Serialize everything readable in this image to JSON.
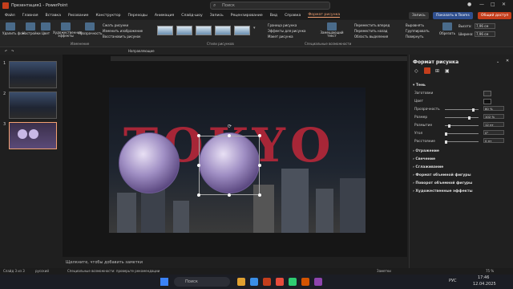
{
  "titlebar": {
    "title": "Презентация1 - PowerPoint",
    "search": "Поиск"
  },
  "menu": [
    "Файл",
    "Главная",
    "Вставка",
    "Рисование",
    "Конструктор",
    "Переходы",
    "Анимация",
    "Слайд-шоу",
    "Запись",
    "Рецензирование",
    "Вид",
    "Справка",
    "Формат рисунка"
  ],
  "header_buttons": {
    "record": "Запись",
    "teams": "Показать в Teams",
    "share": "Общий доступ"
  },
  "ribbon": {
    "adjust_items": [
      "Удалить фон",
      "Настройки",
      "Цвет",
      "Художественные эффекты",
      "Прозрачность"
    ],
    "image_menu": [
      "Сжать рисунки",
      "Изменить изображение",
      "Восстановить рисунок"
    ],
    "adjust_group": "Изменение",
    "style_group": "Стили рисунков",
    "style_menu": [
      "Граница рисунка",
      "Эффекты для рисунка",
      "Макет рисунка"
    ],
    "alt_text": "Замещающий текст",
    "accessibility_group": "Специальные возможности",
    "arrange_items": [
      "Переместить вперед",
      "Переместить назад",
      "Область выделения"
    ],
    "arrange_right": [
      "Выровнять",
      "Группировать",
      "Повернуть"
    ],
    "crop": "Обрезать",
    "height_label": "Высота:",
    "height_value": "7,96 см",
    "width_label": "Ширина:",
    "width_value": "7,96 см"
  },
  "qat": {
    "font_label": "Направляющие"
  },
  "thumbnails": [
    "1",
    "2",
    "3"
  ],
  "slide": {
    "word": "TOKYO"
  },
  "notes": "Щелкните, чтобы добавить заметки",
  "status": {
    "slide": "Слайд 3 из 3",
    "lang": "русский",
    "accessibility": "Специальные возможности: проверьте рекомендации",
    "notes_btn": "Заметки",
    "zoom": "75 %"
  },
  "pane": {
    "title": "Формат рисунка",
    "shadow": "Тень",
    "rows": [
      {
        "label": "Заготовки",
        "value": ""
      },
      {
        "label": "Цвет",
        "value": ""
      },
      {
        "label": "Прозрачность",
        "value": "80 %",
        "pct": 0.8
      },
      {
        "label": "Размер",
        "value": "102 %",
        "pct": 0.68
      },
      {
        "label": "Размытие",
        "value": "12 пт",
        "pct": 0.1
      },
      {
        "label": "Угол",
        "value": "0°",
        "pct": 0
      },
      {
        "label": "Расстояние",
        "value": "0 пт",
        "pct": 0
      }
    ],
    "sections": [
      "Отражение",
      "Свечение",
      "Сглаживание",
      "Формат объемной фигуры",
      "Поворот объемной фигуры",
      "Художественные эффекты"
    ]
  },
  "taskbar": {
    "search": "Поиск",
    "lang": "РУС",
    "time": "17:46",
    "date": "12.04.2025"
  },
  "colors": {
    "accent": "#f3a071",
    "word": "#c0283a"
  }
}
